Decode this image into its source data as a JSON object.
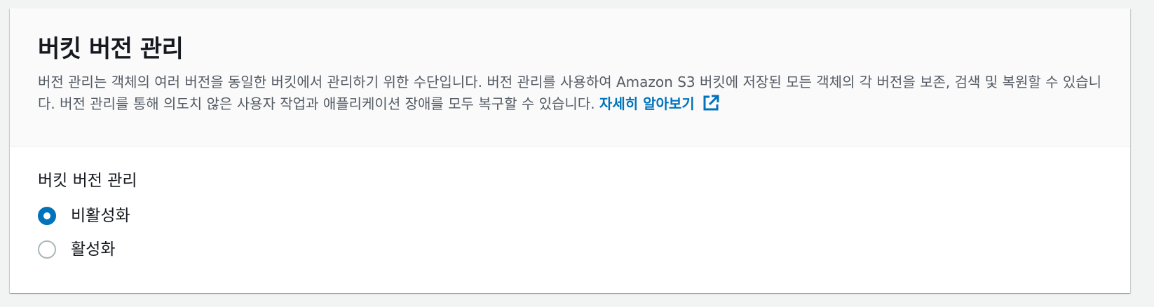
{
  "panel": {
    "title": "버킷 버전 관리",
    "description": "버전 관리는 객체의 여러 버전을 동일한 버킷에서 관리하기 위한 수단입니다. 버전 관리를 사용하여 Amazon S3 버킷에 저장된 모든 객체의 각 버전을 보존, 검색 및 복원할 수 있습니다. 버전 관리를 통해 의도치 않은 사용자 작업과 애플리케이션 장애를 모두 복구할 수 있습니다.",
    "learn_more_label": "자세히 알아보기",
    "learn_more_icon": "external-link-icon"
  },
  "versioning": {
    "label": "버킷 버전 관리",
    "selected": "disabled",
    "options": [
      {
        "label": "비활성화",
        "checked": true
      },
      {
        "label": "활성화",
        "checked": false
      }
    ]
  },
  "colors": {
    "accent": "#0073bb",
    "text": "#16191f",
    "secondary_text": "#545b64",
    "header_bg": "#fafafa",
    "page_bg": "#f2f3f3"
  }
}
